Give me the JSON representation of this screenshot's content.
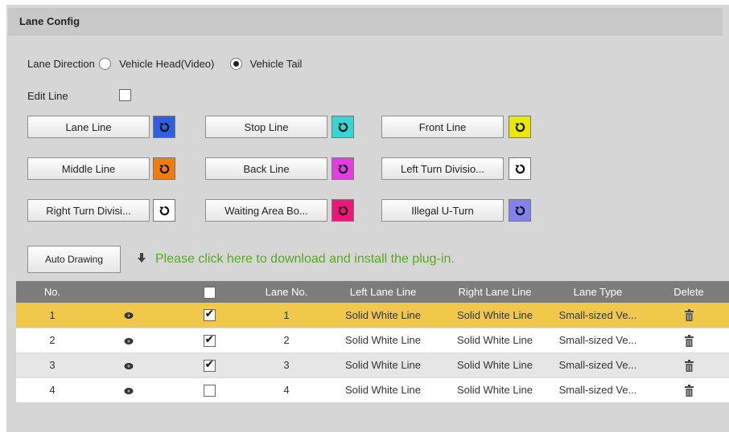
{
  "panel": {
    "title": "Lane Config"
  },
  "direction": {
    "label": "Lane Direction",
    "options": [
      {
        "label": "Vehicle Head(Video)",
        "selected": false
      },
      {
        "label": "Vehicle Tail",
        "selected": true
      }
    ]
  },
  "edit_line": {
    "label": "Edit Line",
    "checked": false
  },
  "line_buttons": [
    {
      "label": "Lane Line",
      "color": "#2e5fe0"
    },
    {
      "label": "Stop Line",
      "color": "#33d6d2"
    },
    {
      "label": "Front Line",
      "color": "#e8e800"
    },
    {
      "label": "Middle Line",
      "color": "#ee7d10"
    },
    {
      "label": "Back Line",
      "color": "#e23ee2"
    },
    {
      "label": "Left Turn Divisio...",
      "color": "#ffffff"
    },
    {
      "label": "Right Turn Divisi...",
      "color": "#ffffff"
    },
    {
      "label": "Waiting Area Bo...",
      "color": "#f0157a"
    },
    {
      "label": "Illegal U-Turn",
      "color": "#8181f0"
    }
  ],
  "auto_drawing": {
    "label": "Auto Drawing",
    "plugin_text": "Please click here to download and install the plug-in.",
    "plugin_color": "#5aa820"
  },
  "table": {
    "headers": [
      "No.",
      "",
      "",
      "Lane No.",
      "Left Lane Line",
      "Right Lane Line",
      "Lane Type",
      "Delete"
    ],
    "header_checked": false,
    "rows": [
      {
        "no": "1",
        "checked": true,
        "lane_no": "1",
        "left": "Solid White Line",
        "right": "Solid White Line",
        "type": "Small-sized Ve...",
        "selected": true
      },
      {
        "no": "2",
        "checked": true,
        "lane_no": "2",
        "left": "Solid White Line",
        "right": "Solid White Line",
        "type": "Small-sized Ve...",
        "selected": false
      },
      {
        "no": "3",
        "checked": true,
        "lane_no": "3",
        "left": "Solid White Line",
        "right": "Solid White Line",
        "type": "Small-sized Ve...",
        "selected": false
      },
      {
        "no": "4",
        "checked": false,
        "lane_no": "4",
        "left": "Solid White Line",
        "right": "Solid White Line",
        "type": "Small-sized Ve...",
        "selected": false
      }
    ]
  },
  "icons": {
    "swatch": "reset-arrow-icon",
    "row_view": "eye-icon",
    "row_delete": "trash-icon",
    "download": "download-arrow-icon"
  },
  "colors": {
    "selected_row": "#f0c94a",
    "table_header": "#7c7c7c",
    "panel_bg": "#d6d6d6"
  }
}
